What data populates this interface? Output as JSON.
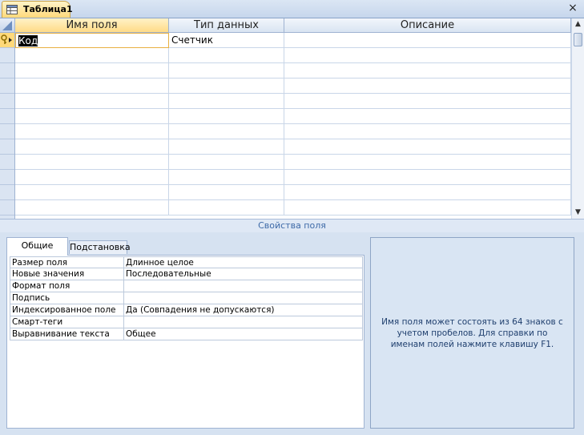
{
  "tab": {
    "title": "Таблица1",
    "close": "×"
  },
  "grid": {
    "headers": [
      "Имя поля",
      "Тип данных",
      "Описание"
    ],
    "rows": [
      {
        "name": "Код",
        "type": "Счетчик",
        "description": "",
        "primary_key": true
      }
    ],
    "empty_rows": 11
  },
  "field_properties": {
    "title": "Свойства поля",
    "tabs": [
      "Общие",
      "Подстановка"
    ],
    "active_tab": "Общие",
    "properties": [
      {
        "name": "Размер поля",
        "value": "Длинное целое"
      },
      {
        "name": "Новые значения",
        "value": "Последовательные"
      },
      {
        "name": "Формат поля",
        "value": ""
      },
      {
        "name": "Подпись",
        "value": ""
      },
      {
        "name": "Индексированное поле",
        "value": "Да (Совпадения не допускаются)"
      },
      {
        "name": "Смарт-теги",
        "value": ""
      },
      {
        "name": "Выравнивание текста",
        "value": "Общее"
      }
    ],
    "help": "Имя поля может состоять из 64 знаков с учетом пробелов.  Для справки по именам полей нажмите клавишу F1."
  },
  "colors": {
    "accent": "#ffd97a",
    "panel": "#d6e2f1",
    "header_blue": "#3e6aa8"
  }
}
